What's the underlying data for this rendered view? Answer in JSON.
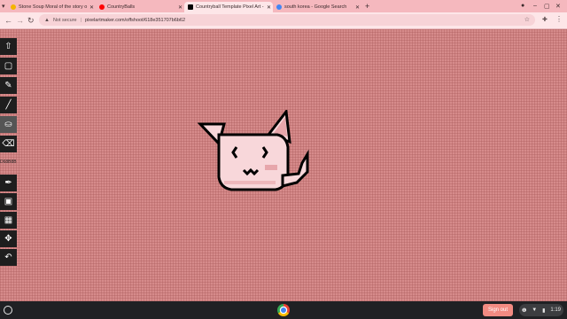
{
  "browser": {
    "tabs": [
      {
        "title": "Stone Soup Moral of the story o",
        "active": false,
        "favicon_color": "#f4b400"
      },
      {
        "title": "CountryBalls",
        "active": false,
        "favicon_color": "#ff0000"
      },
      {
        "title": "Countryball Template Pixel Art -",
        "active": true,
        "favicon_color": "#000000"
      },
      {
        "title": "south korea - Google Search",
        "active": false,
        "favicon_color": "#4285f4"
      }
    ],
    "new_tab_label": "+",
    "not_secure_label": "Not secure",
    "url": "pixelartmaker.com/offshoot/618e351707b6b62",
    "menu_icon": "⋮",
    "bookmark_icon": "☆",
    "extension_icon": "puzzle-icon"
  },
  "tools": [
    {
      "name": "up-arrow-icon",
      "glyph": "⇧"
    },
    {
      "name": "select-icon",
      "glyph": "▢"
    },
    {
      "name": "pencil-icon",
      "glyph": "✎"
    },
    {
      "name": "line-icon",
      "glyph": "╱"
    },
    {
      "name": "bucket-icon",
      "glyph": "⛀"
    },
    {
      "name": "eraser-icon",
      "glyph": "⌫"
    },
    {
      "name": "eyedropper-icon",
      "glyph": "✒"
    },
    {
      "name": "save-icon",
      "glyph": "▣"
    },
    {
      "name": "grid-icon",
      "glyph": "▦"
    },
    {
      "name": "move-icon",
      "glyph": "✥"
    },
    {
      "name": "undo-icon",
      "glyph": "↶"
    }
  ],
  "color_code": "D68B8B",
  "shelf": {
    "sign_out_label": "Sign out",
    "time": "1:19",
    "tray_icons": [
      "info-icon",
      "wifi-icon",
      "battery-icon"
    ]
  }
}
